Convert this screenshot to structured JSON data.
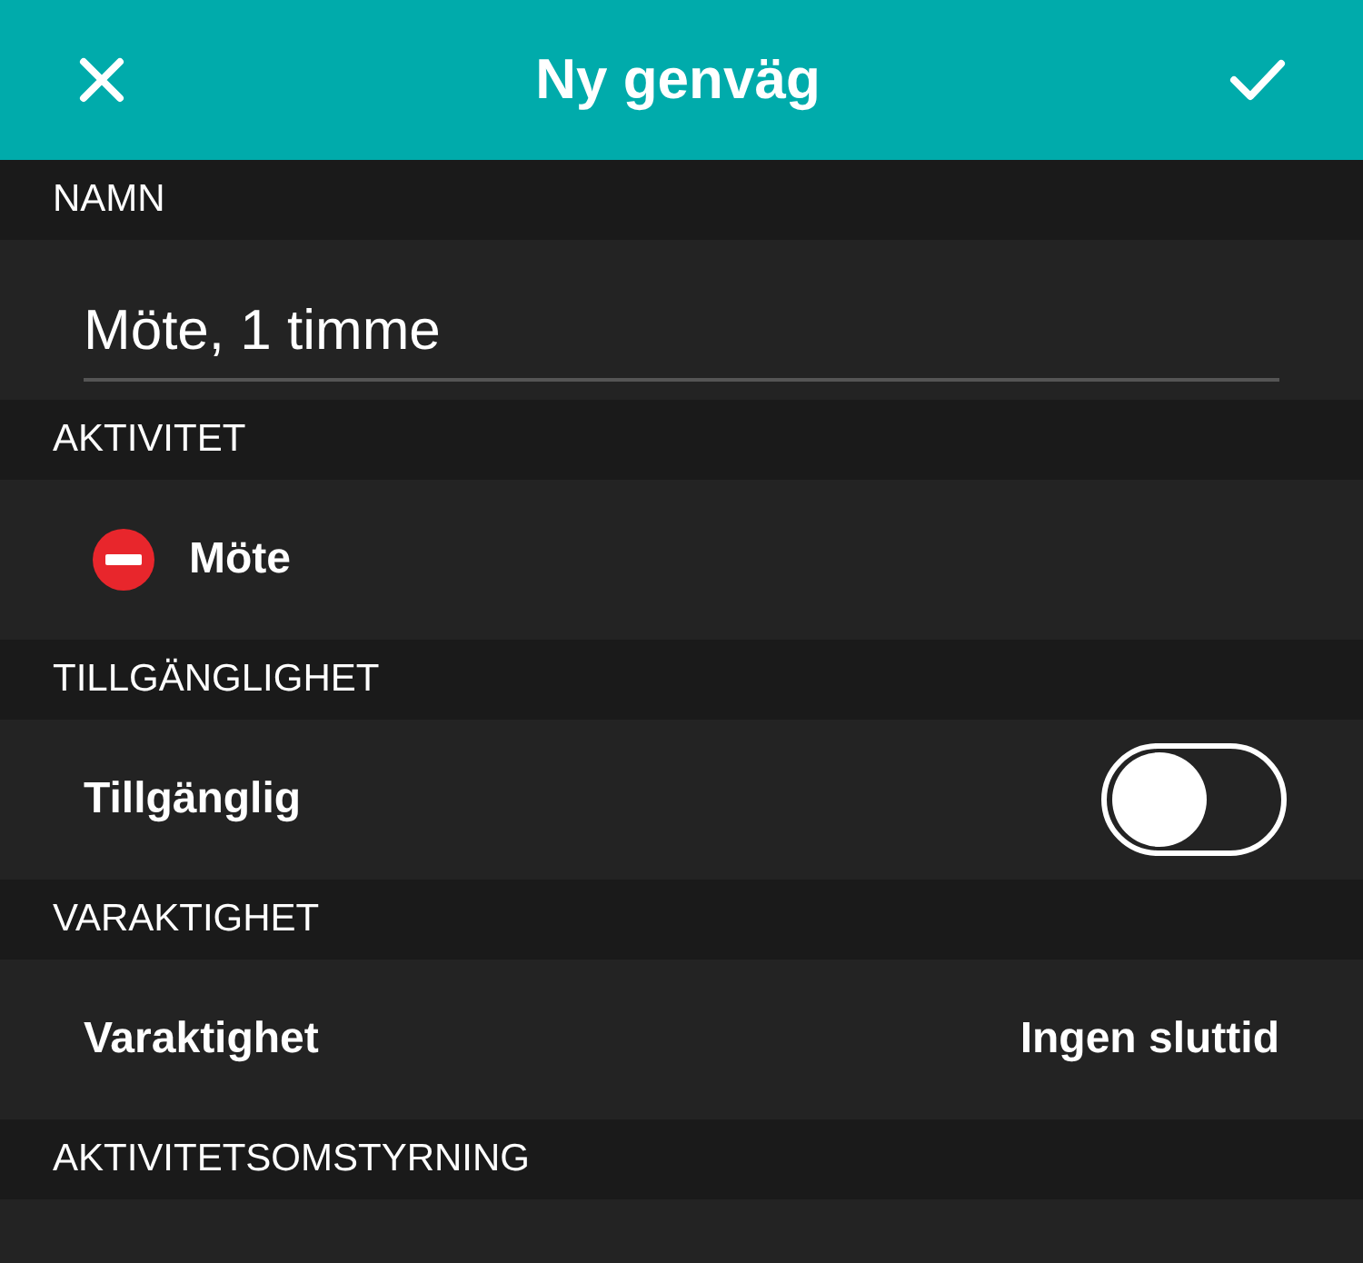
{
  "header": {
    "title": "Ny genväg"
  },
  "sections": [
    {
      "label": "NAMN",
      "row": {
        "kind": "input",
        "value": "Möte, 1 timme"
      }
    },
    {
      "label": "AKTIVITET",
      "row": {
        "kind": "activity",
        "text": "Möte"
      }
    },
    {
      "label": "TILLGÄNGLIGHET",
      "row": {
        "kind": "toggle",
        "text": "Tillgänglig",
        "on": false
      }
    },
    {
      "label": "VARAKTIGHET",
      "row": {
        "kind": "value",
        "text": "Varaktighet",
        "value": "Ingen sluttid"
      }
    },
    {
      "label": "AKTIVITETSOMSTYRNING",
      "row": {
        "kind": "empty"
      }
    }
  ]
}
